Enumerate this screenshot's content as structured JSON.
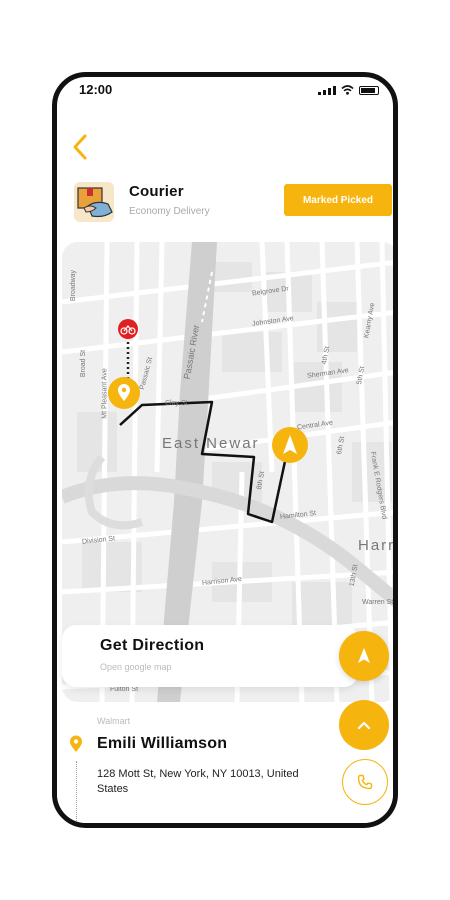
{
  "status_bar": {
    "time": "12:00"
  },
  "courier": {
    "title": "Courier",
    "subtitle": "Economy Delivery",
    "action_label": "Marked Picked"
  },
  "map": {
    "area_label_1": "East Newar",
    "area_label_2": "Harr",
    "streets": {
      "broadway": "Broadway",
      "broad_st": "Broad St",
      "mt_pleasant": "Mt Pleasant Ave",
      "passaic_st": "Passaic St",
      "river": "Passaic River",
      "clay_st": "Clay St",
      "belgrove": "Belgrove Dr",
      "johnston": "Johnston Ave",
      "sherman": "Sherman Ave",
      "central": "Central Ave",
      "kearny": "Kearny Ave",
      "rodgers": "Frank E Rodgers Blvd",
      "hamilton": "Hamilton St",
      "division": "Division St",
      "harrison": "Harrison Ave",
      "warren": "Warren St",
      "fulton": "Fulton St",
      "fourth": "4th St",
      "fifth": "5th St",
      "sixth": "6th St",
      "eighth": "8th St",
      "thirteenth": "13th St"
    }
  },
  "direction": {
    "title": "Get Direction",
    "subtitle": "Open google map"
  },
  "delivery": {
    "store": "Walmart",
    "customer_name": "Emili Williamson",
    "address": "128 Mott St, New York, NY 10013, United States"
  },
  "colors": {
    "accent": "#f6b40e",
    "route": "#111111",
    "bike_marker": "#e02020"
  }
}
